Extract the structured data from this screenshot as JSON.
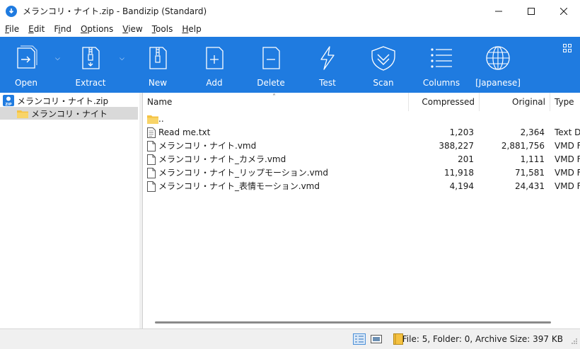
{
  "window": {
    "title": "メランコリ・ナイト.zip - Bandizip (Standard)"
  },
  "menu": [
    {
      "key": "F",
      "rest": "ile"
    },
    {
      "key": "E",
      "rest": "dit"
    },
    {
      "pre": "F",
      "key": "i",
      "rest": "nd"
    },
    {
      "key": "O",
      "rest": "ptions"
    },
    {
      "key": "V",
      "rest": "iew"
    },
    {
      "key": "T",
      "rest": "ools"
    },
    {
      "key": "H",
      "rest": "elp"
    }
  ],
  "toolbar": {
    "open": "Open",
    "extract": "Extract",
    "new": "New",
    "add": "Add",
    "delete": "Delete",
    "test": "Test",
    "scan": "Scan",
    "columns": "Columns",
    "language": "[Japanese]"
  },
  "tree": {
    "root": "メランコリ・ナイト.zip",
    "child": "メランコリ・ナイト"
  },
  "columns": {
    "name": "Name",
    "compressed": "Compressed",
    "original": "Original",
    "type": "Type"
  },
  "files": [
    {
      "name": "..",
      "compressed": "",
      "original": "",
      "type": "",
      "icon": "folder-icon"
    },
    {
      "name": "Read me.txt",
      "compressed": "1,203",
      "original": "2,364",
      "type": "Text D",
      "icon": "text-file-icon"
    },
    {
      "name": "メランコリ・ナイト.vmd",
      "compressed": "388,227",
      "original": "2,881,756",
      "type": "VMD F",
      "icon": "file-icon"
    },
    {
      "name": "メランコリ・ナイト_カメラ.vmd",
      "compressed": "201",
      "original": "1,111",
      "type": "VMD F",
      "icon": "file-icon"
    },
    {
      "name": "メランコリ・ナイト_リップモーション.vmd",
      "compressed": "11,918",
      "original": "71,581",
      "type": "VMD F",
      "icon": "file-icon"
    },
    {
      "name": "メランコリ・ナイト_表情モーション.vmd",
      "compressed": "4,194",
      "original": "24,431",
      "type": "VMD F",
      "icon": "file-icon"
    }
  ],
  "status": {
    "text": "File: 5, Folder: 0, Archive Size: 397 KB"
  },
  "colors": {
    "toolbar": "#1f7be0",
    "folder": "#f5c242"
  }
}
